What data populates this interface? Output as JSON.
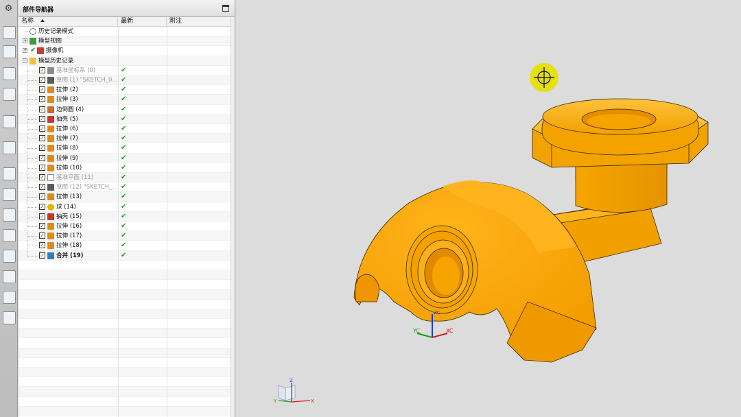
{
  "window": {
    "panel_title": "部件导航器"
  },
  "navigator": {
    "columns": {
      "name": "名称",
      "latest": "最新",
      "notes": "附注"
    },
    "top_nodes": [
      {
        "label": "历史记录模式",
        "icon": "clock-icon"
      },
      {
        "label": "模型视图",
        "icon": "model-views-icon"
      },
      {
        "label": "摄像机",
        "icon": "camera-icon"
      },
      {
        "label": "模型历史记录",
        "icon": "folder-icon"
      }
    ],
    "features": [
      {
        "label": "基准坐标系 (0)",
        "grey": true,
        "bold": false,
        "icon": "datum-csys-icon"
      },
      {
        "label": "草图 (1) \"SKETCH_0...",
        "grey": true,
        "bold": false,
        "icon": "sketch-icon"
      },
      {
        "label": "拉伸 (2)",
        "grey": false,
        "bold": false,
        "icon": "extrude-icon"
      },
      {
        "label": "拉伸 (3)",
        "grey": false,
        "bold": false,
        "icon": "extrude-icon"
      },
      {
        "label": "边倒圆 (4)",
        "grey": false,
        "bold": false,
        "icon": "edge-blend-icon"
      },
      {
        "label": "抽壳 (5)",
        "grey": false,
        "bold": false,
        "icon": "shell-icon"
      },
      {
        "label": "拉伸 (6)",
        "grey": false,
        "bold": false,
        "icon": "extrude-icon"
      },
      {
        "label": "拉伸 (7)",
        "grey": false,
        "bold": false,
        "icon": "extrude-icon"
      },
      {
        "label": "拉伸 (8)",
        "grey": false,
        "bold": false,
        "icon": "extrude-icon"
      },
      {
        "label": "拉伸 (9)",
        "grey": false,
        "bold": false,
        "icon": "extrude-icon"
      },
      {
        "label": "拉伸 (10)",
        "grey": false,
        "bold": false,
        "icon": "extrude-icon"
      },
      {
        "label": "基准平面 (11)",
        "grey": true,
        "bold": false,
        "icon": "datum-plane-icon"
      },
      {
        "label": "草图 (12) \"SKETCH_...",
        "grey": true,
        "bold": false,
        "icon": "sketch-icon"
      },
      {
        "label": "拉伸 (13)",
        "grey": false,
        "bold": false,
        "icon": "extrude-icon"
      },
      {
        "label": "球 (14)",
        "grey": false,
        "bold": false,
        "icon": "sphere-icon"
      },
      {
        "label": "抽壳 (15)",
        "grey": false,
        "bold": false,
        "icon": "shell-icon"
      },
      {
        "label": "拉伸 (16)",
        "grey": false,
        "bold": false,
        "icon": "extrude-icon"
      },
      {
        "label": "拉伸 (17)",
        "grey": false,
        "bold": false,
        "icon": "extrude-icon"
      },
      {
        "label": "拉伸 (18)",
        "grey": false,
        "bold": false,
        "icon": "extrude-icon"
      },
      {
        "label": "合并 (19)",
        "grey": false,
        "bold": true,
        "icon": "unite-icon"
      }
    ],
    "latest_mark": "✔"
  },
  "viewport": {
    "csys_labels": {
      "xc": "XC",
      "yc": "YC",
      "zc": "ZC"
    },
    "triad_labels": {
      "x": "X",
      "y": "Y",
      "z": "Z"
    }
  },
  "colors": {
    "part": "#f5a300",
    "part_dark": "#c98100",
    "cursor": "#e4e014",
    "background": "#dcdcdc"
  }
}
